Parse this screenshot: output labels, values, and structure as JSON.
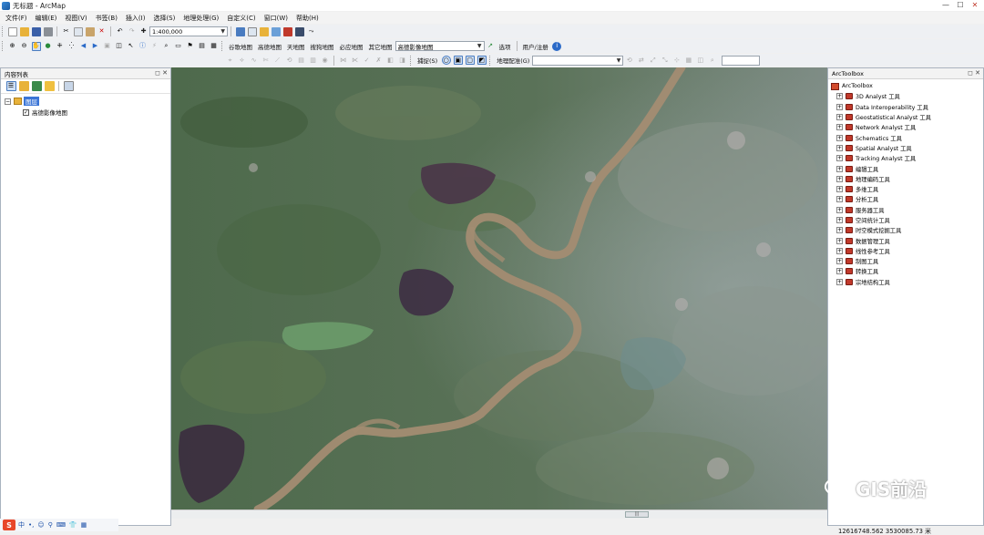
{
  "window": {
    "title": "无标题 - ArcMap"
  },
  "menu": [
    "文件(F)",
    "编辑(E)",
    "视图(V)",
    "书签(B)",
    "插入(I)",
    "选择(S)",
    "地理处理(G)",
    "自定义(C)",
    "窗口(W)",
    "帮助(H)"
  ],
  "toolbar": {
    "scale": "1:400,000",
    "basemaps": [
      "谷歌地图",
      "高德地图",
      "天地图",
      "搜狗地图",
      "必应地图",
      "其它地图"
    ],
    "layer_select": "高德影像地图",
    "select_label": "选项",
    "user_label": "用户/注册",
    "snapping_label": "捕捉(S)",
    "georef_label": "地理配准(G)"
  },
  "toc": {
    "title": "内容列表",
    "layer_group": "图层",
    "layer": "高德影像地图",
    "layer_checked": true
  },
  "toolbox": {
    "title": "ArcToolbox",
    "root": "ArcToolbox",
    "items": [
      "3D Analyst 工具",
      "Data Interoperability 工具",
      "Geostatistical Analyst 工具",
      "Network Analyst 工具",
      "Schematics 工具",
      "Spatial Analyst 工具",
      "Tracking Analyst 工具",
      "编辑工具",
      "地理编码工具",
      "多维工具",
      "分析工具",
      "服务器工具",
      "空间统计工具",
      "时空模式挖掘工具",
      "数据管理工具",
      "线性参考工具",
      "制图工具",
      "转换工具",
      "宗地结构工具"
    ]
  },
  "status": {
    "coordinates": "12616748.562  3530085.73 米"
  },
  "watermark": {
    "text": "GIS前沿"
  },
  "tray": {
    "ime_label": "S",
    "items": [
      "中",
      "•,",
      "☺",
      "⚲",
      "⌨",
      "👕",
      "▦"
    ]
  },
  "colors": {
    "title_bg": "#ffffff",
    "panel_border": "#a9b3bf",
    "river": "#a38c72",
    "selection": "#3b75d6"
  }
}
